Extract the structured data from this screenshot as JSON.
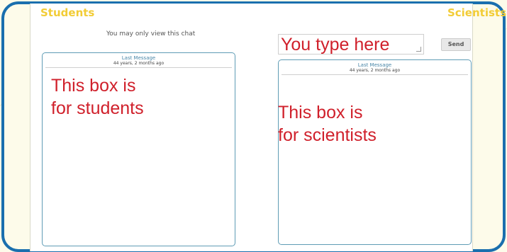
{
  "students": {
    "title": "Students",
    "view_only_notice": "You may only view this chat",
    "box_header_title": "Last Message",
    "box_header_time": "44 years, 2 months ago",
    "overlay_line1": "This box is",
    "overlay_line2": "for students"
  },
  "scientists": {
    "title": "Scientists",
    "input_text": "You type here",
    "send_label": "Send",
    "box_header_title": "Last Message",
    "box_header_time": "44 years, 2 months ago",
    "overlay_line1": "This box is",
    "overlay_line2": "for scientists"
  },
  "colors": {
    "frame_border": "#1a6fae",
    "heading_yellow": "#f2cc36",
    "annotation_red": "#d0202b",
    "box_border": "#5f9cb5"
  }
}
